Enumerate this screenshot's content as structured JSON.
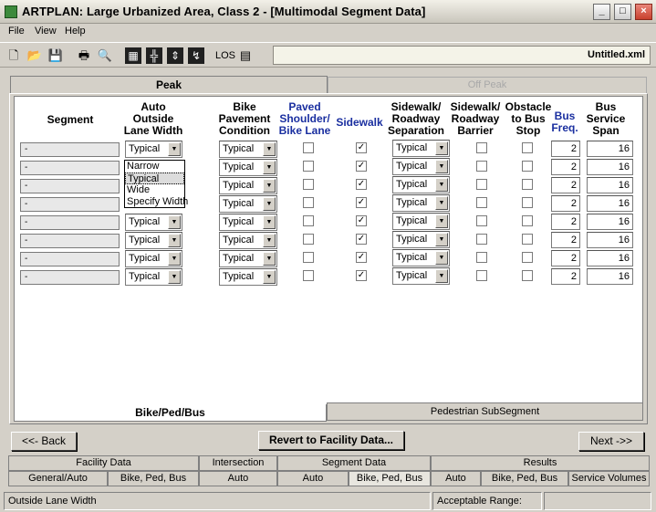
{
  "window": {
    "title": "ARTPLAN: Large Urbanized Area, Class 2 - [Multimodal Segment Data]"
  },
  "menu": [
    "File",
    "View",
    "Help"
  ],
  "toolbar": {
    "filename": "Untitled.xml"
  },
  "tabs": {
    "peak": "Peak",
    "offpeak": "Off Peak"
  },
  "headers": {
    "segment": "Segment",
    "auto_width": [
      "Auto",
      "Outside",
      "Lane Width"
    ],
    "bike_pavement": [
      "Bike",
      "Pavement",
      "Condition"
    ],
    "paved_shoulder": [
      "Paved",
      "Shoulder/",
      "Bike Lane"
    ],
    "sidewalk": "Sidewalk",
    "sw_separation": [
      "Sidewalk/",
      "Roadway",
      "Separation"
    ],
    "sw_barrier": [
      "Sidewalk/",
      "Roadway",
      "Barrier"
    ],
    "obstacle": [
      "Obstacle",
      "to Bus",
      "Stop"
    ],
    "bus_freq": [
      "Bus",
      "Freq."
    ],
    "bus_span": [
      "Bus",
      "Service",
      "Span"
    ]
  },
  "rows": [
    {
      "segment": "-",
      "auto_width": "Typical",
      "bike_pavement": "Typical",
      "paved_shoulder": false,
      "sidewalk": true,
      "separation": "Typical",
      "barrier": false,
      "obstacle": false,
      "bus_freq": "2",
      "bus_span": "16"
    },
    {
      "segment": "-",
      "auto_width": "Typical",
      "bike_pavement": "Typical",
      "paved_shoulder": false,
      "sidewalk": true,
      "separation": "Typical",
      "barrier": false,
      "obstacle": false,
      "bus_freq": "2",
      "bus_span": "16"
    },
    {
      "segment": "-",
      "auto_width": "Typical",
      "bike_pavement": "Typical",
      "paved_shoulder": false,
      "sidewalk": true,
      "separation": "Typical",
      "barrier": false,
      "obstacle": false,
      "bus_freq": "2",
      "bus_span": "16"
    },
    {
      "segment": "-",
      "auto_width": "Typical",
      "bike_pavement": "Typical",
      "paved_shoulder": false,
      "sidewalk": true,
      "separation": "Typical",
      "barrier": false,
      "obstacle": false,
      "bus_freq": "2",
      "bus_span": "16"
    },
    {
      "segment": "-",
      "auto_width": "Typical",
      "bike_pavement": "Typical",
      "paved_shoulder": false,
      "sidewalk": true,
      "separation": "Typical",
      "barrier": false,
      "obstacle": false,
      "bus_freq": "2",
      "bus_span": "16"
    },
    {
      "segment": "-",
      "auto_width": "Typical",
      "bike_pavement": "Typical",
      "paved_shoulder": false,
      "sidewalk": true,
      "separation": "Typical",
      "barrier": false,
      "obstacle": false,
      "bus_freq": "2",
      "bus_span": "16"
    },
    {
      "segment": "-",
      "auto_width": "Typical",
      "bike_pavement": "Typical",
      "paved_shoulder": false,
      "sidewalk": true,
      "separation": "Typical",
      "barrier": false,
      "obstacle": false,
      "bus_freq": "2",
      "bus_span": "16"
    },
    {
      "segment": "-",
      "auto_width": "Typical",
      "bike_pavement": "Typical",
      "paved_shoulder": false,
      "sidewalk": true,
      "separation": "Typical",
      "barrier": false,
      "obstacle": false,
      "bus_freq": "2",
      "bus_span": "16"
    }
  ],
  "dropdown_options": [
    "Narrow",
    "Typical",
    "Wide",
    "Specify Width"
  ],
  "subtabs": {
    "left": "Bike/Ped/Bus",
    "right": "Pedestrian SubSegment"
  },
  "buttons": {
    "back": "<<- Back",
    "revert": "Revert to Facility Data...",
    "next": "Next ->>"
  },
  "nav": {
    "groups": [
      "Facility Data",
      "Intersection",
      "Segment Data",
      "Results"
    ],
    "items": [
      "General/Auto",
      "Bike, Ped, Bus",
      "Auto",
      "Auto",
      "Bike, Ped, Bus",
      "Auto",
      "Bike, Ped, Bus",
      "Service Volumes"
    ]
  },
  "status": {
    "message": "Outside Lane Width",
    "range_label": "Acceptable Range:"
  }
}
